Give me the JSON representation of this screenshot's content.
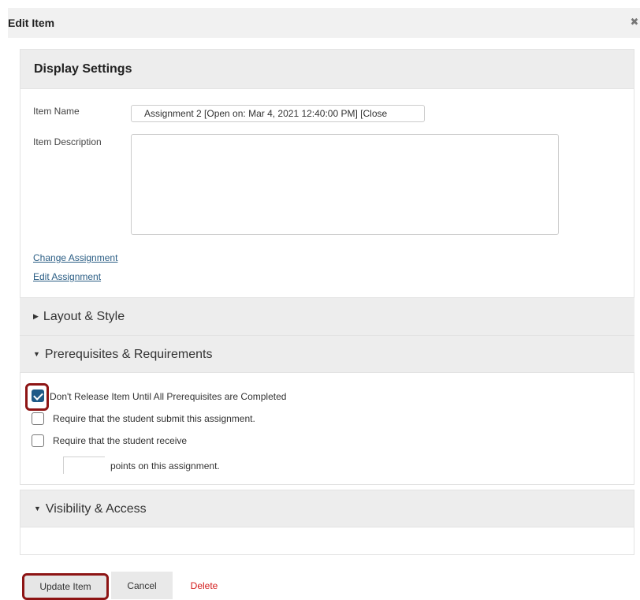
{
  "dialog": {
    "title": "Edit Item",
    "close_icon": "close-icon"
  },
  "display_settings": {
    "heading": "Display Settings",
    "item_name_label": "Item Name",
    "item_name_value": "Assignment 2 [Open on: Mar 4, 2021 12:40:00 PM] [Close",
    "item_description_label": "Item Description",
    "item_description_value": "",
    "change_assignment_link": "Change Assignment",
    "edit_assignment_link": "Edit Assignment"
  },
  "sections": {
    "layout_style": {
      "label": "Layout & Style",
      "expanded": false
    },
    "prerequisites": {
      "label": "Prerequisites & Requirements",
      "expanded": true
    },
    "visibility": {
      "label": "Visibility & Access",
      "expanded": true
    }
  },
  "prerequisites": {
    "dont_release": {
      "label": "Don't Release Item Until All Prerequisites are Completed",
      "checked": true
    },
    "require_submit": {
      "label": "Require that the student submit this assignment.",
      "checked": false
    },
    "require_receive": {
      "label": "Require that the student receive",
      "checked": false
    },
    "points_value": "",
    "points_suffix": "points on this assignment."
  },
  "buttons": {
    "update": "Update Item",
    "cancel": "Cancel",
    "delete": "Delete"
  },
  "colors": {
    "highlight": "#8d1414",
    "checkbox_checked": "#1f5a87",
    "link": "#2a5d84",
    "delete": "#d31a1a"
  }
}
